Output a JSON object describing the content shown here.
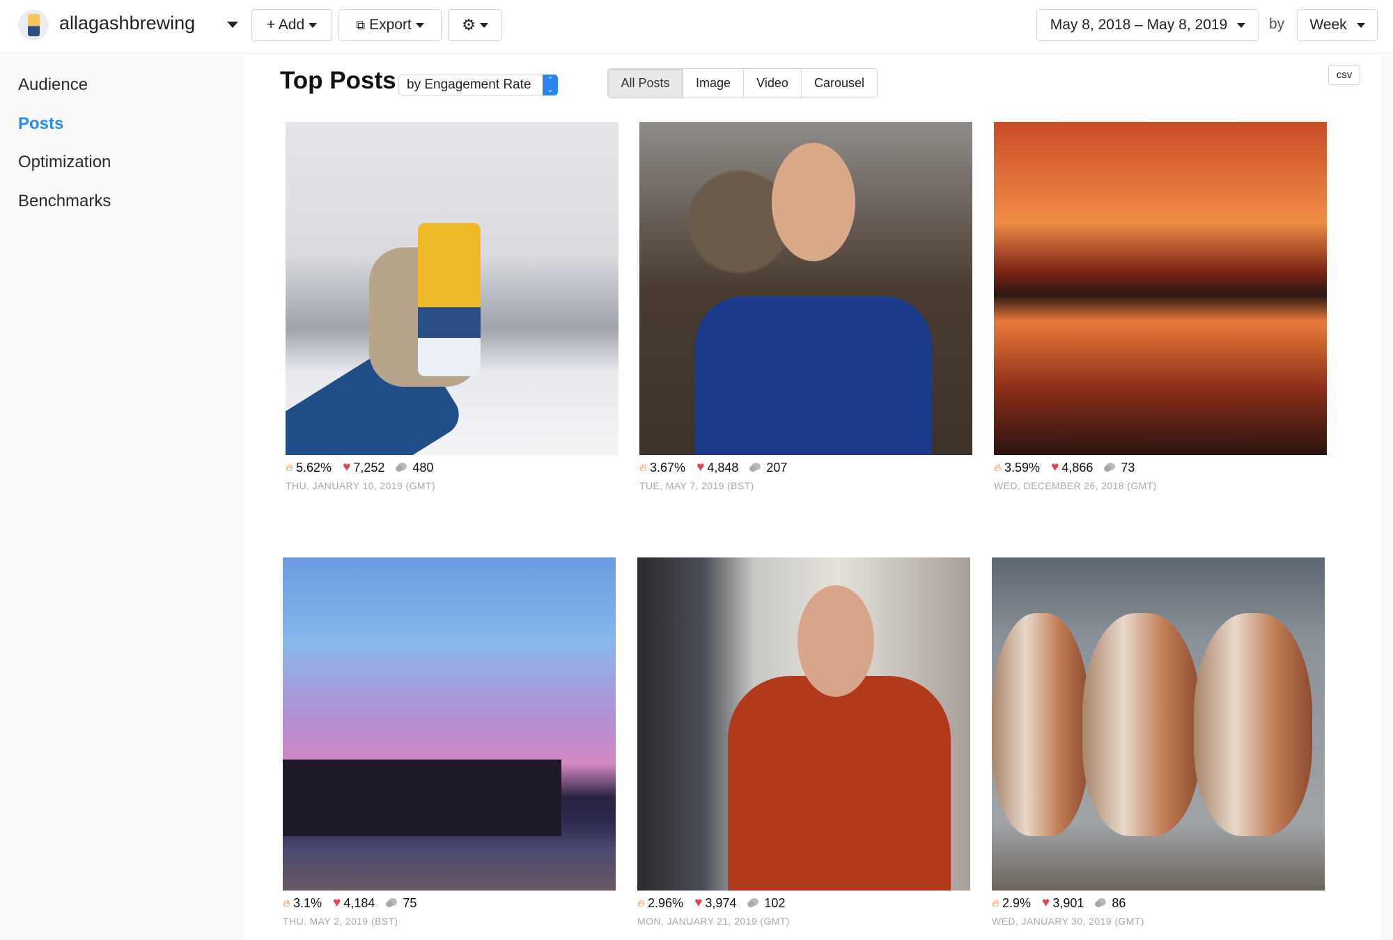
{
  "header": {
    "account_name": "allagashbrewing",
    "add_label": "+ Add",
    "export_label": "Export",
    "layers_icon": "⧉",
    "gear_icon": "⚙",
    "date_range": "May 8, 2018 – May 8, 2019",
    "by_label": "by",
    "interval": "Week"
  },
  "sidebar": {
    "items": [
      {
        "label": "Audience",
        "active": false
      },
      {
        "label": "Posts",
        "active": true
      },
      {
        "label": "Optimization",
        "active": false
      },
      {
        "label": "Benchmarks",
        "active": false
      }
    ]
  },
  "main": {
    "title": "Top Posts",
    "sort_select": "by Engagement Rate",
    "stepper_glyph": "⌃⌄",
    "filters": [
      {
        "label": "All Posts",
        "active": true
      },
      {
        "label": "Image",
        "active": false
      },
      {
        "label": "Video",
        "active": false
      },
      {
        "label": "Carousel",
        "active": false
      }
    ],
    "csv_label": "csv",
    "icons": {
      "flame": "🔥",
      "heart": "♥"
    },
    "posts": [
      {
        "engagement_rate": "5.62%",
        "likes": "7,252",
        "comments": "480",
        "date": "THU, JANUARY 10, 2019 (GMT)",
        "subject": "mittened hand holding Allagash White can in snow"
      },
      {
        "engagement_rate": "3.67%",
        "likes": "4,848",
        "comments": "207",
        "date": "TUE, MAY 7, 2019 (BST)",
        "subject": "bearded man in blue Allagash shirt among barrels"
      },
      {
        "engagement_rate": "3.59%",
        "likes": "4,866",
        "comments": "73",
        "date": "WED, DECEMBER 26, 2018 (GMT)",
        "subject": "orange sunset reflected in harbor"
      },
      {
        "engagement_rate": "3.1%",
        "likes": "4,184",
        "comments": "75",
        "date": "THU, MAY 2, 2019 (BST)",
        "subject": "pier at dusk under pink and blue sky"
      },
      {
        "engagement_rate": "2.96%",
        "likes": "3,974",
        "comments": "102",
        "date": "MON, JANUARY 21, 2019 (GMT)",
        "subject": "man in red jacket inspecting a can"
      },
      {
        "engagement_rate": "2.9%",
        "likes": "3,901",
        "comments": "86",
        "date": "WED, JANUARY 30, 2019 (GMT)",
        "subject": "rusty fermentation tanks"
      }
    ]
  },
  "colors": {
    "accent": "#2c8bef",
    "flame": "#f27a2c",
    "heart": "#ec3f4e",
    "muted_text": "#a8abb1"
  }
}
